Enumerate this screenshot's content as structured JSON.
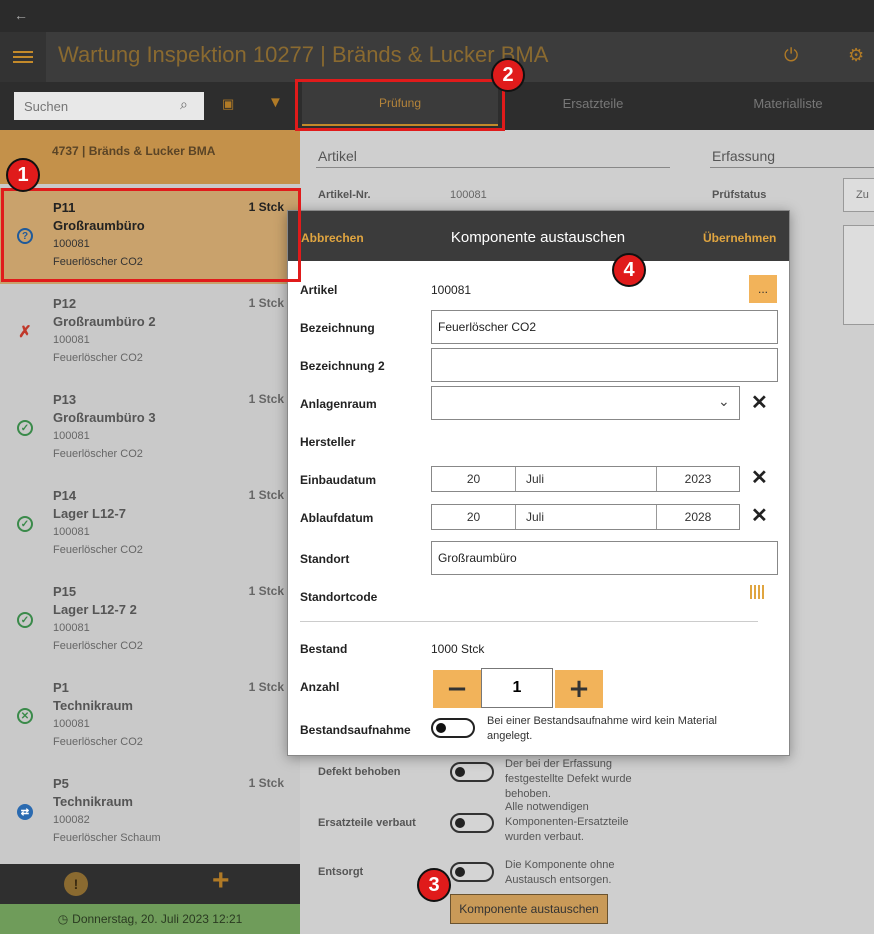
{
  "app": {
    "title": "Wartung Inspektion 10277  |  Bränds & Lucker BMA"
  },
  "toolbar": {
    "search_placeholder": "Suchen",
    "tabs": [
      {
        "label": "Prüfung",
        "active": true
      },
      {
        "label": "Ersatzteile",
        "active": false
      },
      {
        "label": "Materialliste",
        "active": false
      }
    ]
  },
  "sidebar": {
    "customer": "4737  |  Bränds & Lucker BMA",
    "items": [
      {
        "code": "P11",
        "qty": "1 Stck",
        "room": "Großraumbüro",
        "artno": "100081",
        "desc": "Feuerlöscher CO2",
        "status_icon": "question-icon",
        "selected": true
      },
      {
        "code": "P12",
        "qty": "1 Stck",
        "room": "Großraumbüro 2",
        "artno": "100081",
        "desc": "Feuerlöscher CO2",
        "status_icon": "defect-icon",
        "selected": false
      },
      {
        "code": "P13",
        "qty": "1 Stck",
        "room": "Großraumbüro 3",
        "artno": "100081",
        "desc": "Feuerlöscher CO2",
        "status_icon": "check-icon",
        "selected": false
      },
      {
        "code": "P14",
        "qty": "1 Stck",
        "room": "Lager L12-7",
        "artno": "100081",
        "desc": "Feuerlöscher CO2",
        "status_icon": "check-icon",
        "selected": false
      },
      {
        "code": "P15",
        "qty": "1 Stck",
        "room": "Lager L12-7 2",
        "artno": "100081",
        "desc": "Feuerlöscher CO2",
        "status_icon": "check-icon",
        "selected": false
      },
      {
        "code": "P1",
        "qty": "1 Stck",
        "room": "Technikraum",
        "artno": "100081",
        "desc": "Feuerlöscher CO2",
        "status_icon": "cross-icon",
        "selected": false
      },
      {
        "code": "P5",
        "qty": "1 Stck",
        "room": "Technikraum",
        "artno": "100082",
        "desc": "Feuerlöscher Schaum",
        "status_icon": "swap-icon",
        "selected": false
      }
    ],
    "status_bar": "Donnerstag, 20. Juli 2023 12:21"
  },
  "main": {
    "section_artikel": "Artikel",
    "section_erfassung": "Erfassung",
    "artikel_nr_label": "Artikel-Nr.",
    "artikel_nr_value": "100081",
    "pruefstatus_label": "Prüfstatus",
    "pruefstatus_value": "Zu",
    "toggles": [
      {
        "label": "Defekt behoben",
        "note": "Der bei der Erfassung festgestellte Defekt wurde behoben."
      },
      {
        "label": "Ersatzteile verbaut",
        "note": "Alle notwendigen Komponenten-Ersatzteile wurden verbaut."
      },
      {
        "label": "Entsorgt",
        "note": "Die Komponente ohne Austausch entsorgen."
      }
    ],
    "replace_button": "Komponente austauschen"
  },
  "dialog": {
    "cancel": "Abbrechen",
    "title": "Komponente austauschen",
    "ok": "Übernehmen",
    "artikel_label": "Artikel",
    "artikel_value": "100081",
    "dots_button": "...",
    "bezeichnung_label": "Bezeichnung",
    "bezeichnung_value": "Feuerlöscher CO2",
    "bezeichnung2_label": "Bezeichnung 2",
    "bezeichnung2_value": "",
    "anlagenraum_label": "Anlagenraum",
    "hersteller_label": "Hersteller",
    "einbaudatum_label": "Einbaudatum",
    "einbaudatum": {
      "day": "20",
      "month": "Juli",
      "year": "2023"
    },
    "ablaufdatum_label": "Ablaufdatum",
    "ablaufdatum": {
      "day": "20",
      "month": "Juli",
      "year": "2028"
    },
    "standort_label": "Standort",
    "standort_value": "Großraumbüro",
    "standortcode_label": "Standortcode",
    "bestand_label": "Bestand",
    "bestand_value": "1000 Stck",
    "anzahl_label": "Anzahl",
    "anzahl_value": "1",
    "bestandsaufnahme_label": "Bestandsaufnahme",
    "bestandsaufnahme_note": "Bei einer Bestandsaufnahme wird kein Material angelegt."
  },
  "callouts": [
    "1",
    "2",
    "3",
    "4"
  ],
  "colors": {
    "accent": "#f2b35a",
    "callout": "#e01b1b",
    "header": "#3b3b3b"
  }
}
